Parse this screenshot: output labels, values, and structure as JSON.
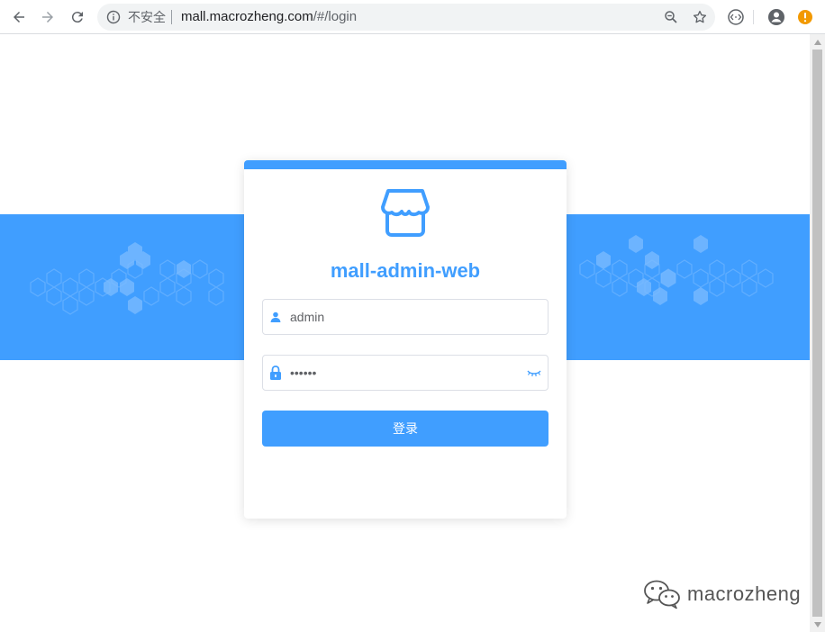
{
  "browser": {
    "security_label": "不安全",
    "url_host": "mall.macrozheng.com",
    "url_path": "/#/login"
  },
  "login": {
    "title": "mall-admin-web",
    "username_value": "admin",
    "password_value": "••••••",
    "submit_label": "登录"
  },
  "watermark": {
    "text": "macrozheng"
  },
  "colors": {
    "primary": "#409eff",
    "border": "#dcdfe6",
    "warning": "#f29900"
  },
  "icons": [
    "back-icon",
    "forward-icon",
    "reload-icon",
    "info-icon",
    "zoom-icon",
    "star-icon",
    "extension-icon",
    "account-icon",
    "alert-icon",
    "shop-logo-icon",
    "user-icon",
    "lock-icon",
    "eye-closed-icon",
    "wechat-icon"
  ]
}
